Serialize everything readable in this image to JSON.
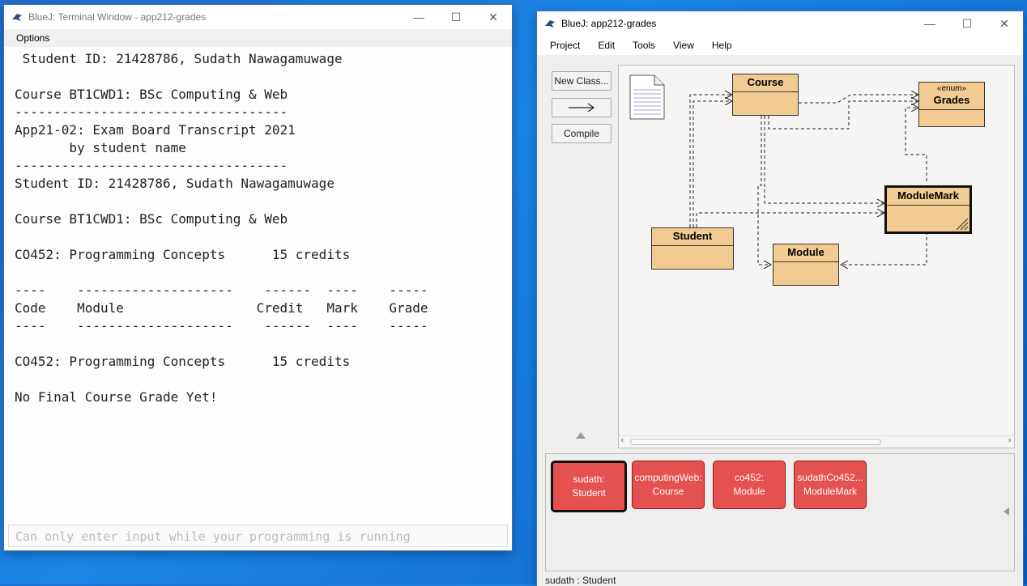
{
  "terminal": {
    "title": "BlueJ: Terminal Window - app212-grades",
    "menu": [
      "Options"
    ],
    "lines": [
      " Student ID: 21428786, Sudath Nawagamuwage",
      "",
      "Course BT1CWD1: BSc Computing & Web",
      "-----------------------------------",
      "App21-02: Exam Board Transcript 2021",
      "       by student name",
      "-----------------------------------",
      "Student ID: 21428786, Sudath Nawagamuwage",
      "",
      "Course BT1CWD1: BSc Computing & Web",
      "",
      "CO452: Programming Concepts      15 credits",
      "",
      "----    --------------------    ------  ----    -----",
      "Code    Module                 Credit   Mark    Grade",
      "----    --------------------    ------  ----    -----",
      "",
      "CO452: Programming Concepts      15 credits",
      "",
      "No Final Course Grade Yet!"
    ],
    "input_placeholder": "Can only enter input while your programming is running"
  },
  "main": {
    "title": "BlueJ:  app212-grades",
    "menu": [
      "Project",
      "Edit",
      "Tools",
      "View",
      "Help"
    ],
    "buttons": {
      "new_class": "New Class...",
      "compile": "Compile"
    },
    "classes": {
      "course": "Course",
      "grades_stereotype": "«enum»",
      "grades": "Grades",
      "module_mark": "ModuleMark",
      "student": "Student",
      "module": "Module"
    },
    "objects": [
      {
        "name": "sudath:",
        "type": "Student"
      },
      {
        "name": "computingWeb:",
        "type": "Course"
      },
      {
        "name": "co452:",
        "type": "Module"
      },
      {
        "name": "sudathCo452...",
        "type": "ModuleMark"
      }
    ],
    "status": "sudath : Student"
  },
  "colors": {
    "class_fill": "#f2cb92",
    "object_fill": "#e55050",
    "desktop": "#1a86e6"
  }
}
